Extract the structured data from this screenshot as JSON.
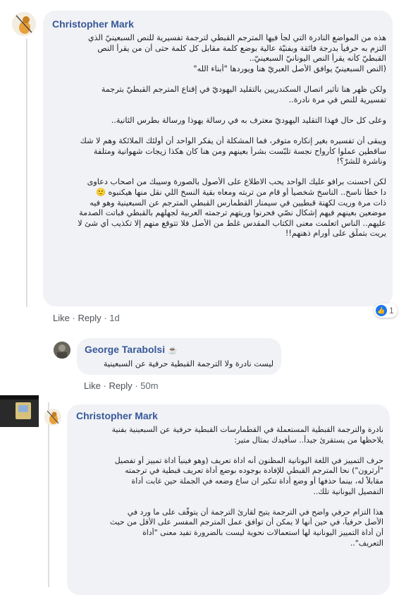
{
  "comments": [
    {
      "author": "Christopher Mark",
      "lines": [
        "هذه من المواضع النادرة التي لجأ فيها المترجم القبطي لترجمة تفسيرية للنص السبعينيّ الذي",
        "التزم به حرفياً بدرجة فائقة وبفنيّة عالية بوضع كلمة مقابل كل كلمة حتى أن من يقرأ النص",
        "القبطيّ كأنه يقرأ النص اليونانيّ السبعينيّ..",
        "(النص السبعينيّ يوافق الأصل العبريّ هنا ويوردها \"أبناء الله\"",
        "",
        "ولكن ظهر هنا تأثير اتصال السكندريين بالتقليد اليهوديّ في إقناع المترجم القبطيّ بترجمة",
        "تفسيرية للنص في مرة نادرة..",
        "",
        "وعلى كل حال فهذا التقليد اليهوديّ معترف به في رسالة يهوذا ورسالة بطرس الثانية..",
        "",
        "ويبقى أن تفسيره بغير إنكاره متوفر، فما المشكلة أن يفكر الواحد أن أولئك الملائكة وهم لا شك",
        "ساقطين عملوا كأرواح نجسة تلبّست بشراً بعينهم ومن هنا كان هكذا زيجات شهوانية ومتلفة",
        "وناشرة للشرّ؟!",
        "",
        "لكن احسنت برافو عليك الواحد يحب الاطلاع على الأصول بالصورة وسيبك من اصحاب دعاوى",
        "دا خطأ ناسخ.. الناسخ شخصياً أو قام من تربته ومعاه بقية النسخ اللي نقل منها هيكنبوه 🙂",
        "ذات مرة وريت لكهنة قبطيين في سيمنار القطمارس القبطي المترجم عن السبعينية وهو فيه",
        "موضعين بعينهم فيهم إشكال نصّي فحرنوا وريتهم ترجمته العربية لجهلهم بالقبطي فباتت الصدمة",
        "عليهم.. الناس اتعلمت معنى الكتاب المقدس غلط من الأصل فلا تتوقع منهم إلا تكذيب أي شئ لا",
        "يريت بتملّق على أورام ذهنهم!!"
      ],
      "actions": {
        "like": "Like",
        "reply": "Reply",
        "time": "1d"
      },
      "reaction_count": "1"
    },
    {
      "author": "George Tarabolsi",
      "badge_icon": "coffee-cup-icon",
      "lines": [
        "ليست نادرة ولا الترجمة القبطية حرفية عن السبعينية"
      ],
      "actions": {
        "like": "Like",
        "reply": "Reply",
        "time": "50m"
      }
    },
    {
      "author": "Christopher Mark",
      "lines": [
        "نادرة والترجمة القبطية المستعملة في القطمارسات القبطية حرفية عن السبعينية بفنية",
        "يلاحظها من يستقرئ جيداً.. سأفيدك بمثال متير:",
        "",
        "حرف التمييز في اللغة اليونانية المظنون أنه اداة تعريف (وهو فينياً اداة تمييز أو تفصيل",
        "\"أرثرون\") نحا المترجم القبطي للإفادة بوجوده بوضع أداة تعريف قبطية في ترجمته",
        "مقابلاً له، بينما حذفها أو وضع أداة تنكير ان ساع وضعه في الجملة حين غابت أداة",
        "التفصيل اليونانية تلك..",
        "",
        "هذا التزام حرفي واضح في الترجمة يتيح لقارئ الترجمة أن يتوقّف على ما ورد في",
        "الأصل حرفياً، في حين أنها لا يمكن أن توافق عمل المترجم المفسر على الأقل من حيث",
        "أن أداة التمييز اليونانية لها استعمالات نحوية ليست بالضرورة تفيد معنى \"أداة",
        "التعريف\".."
      ]
    }
  ],
  "colors": {
    "author": "#385898",
    "bubble": "#f0f2f5",
    "like_blue": "#1877f2",
    "text": "#1c1e21",
    "meta": "#606770"
  }
}
